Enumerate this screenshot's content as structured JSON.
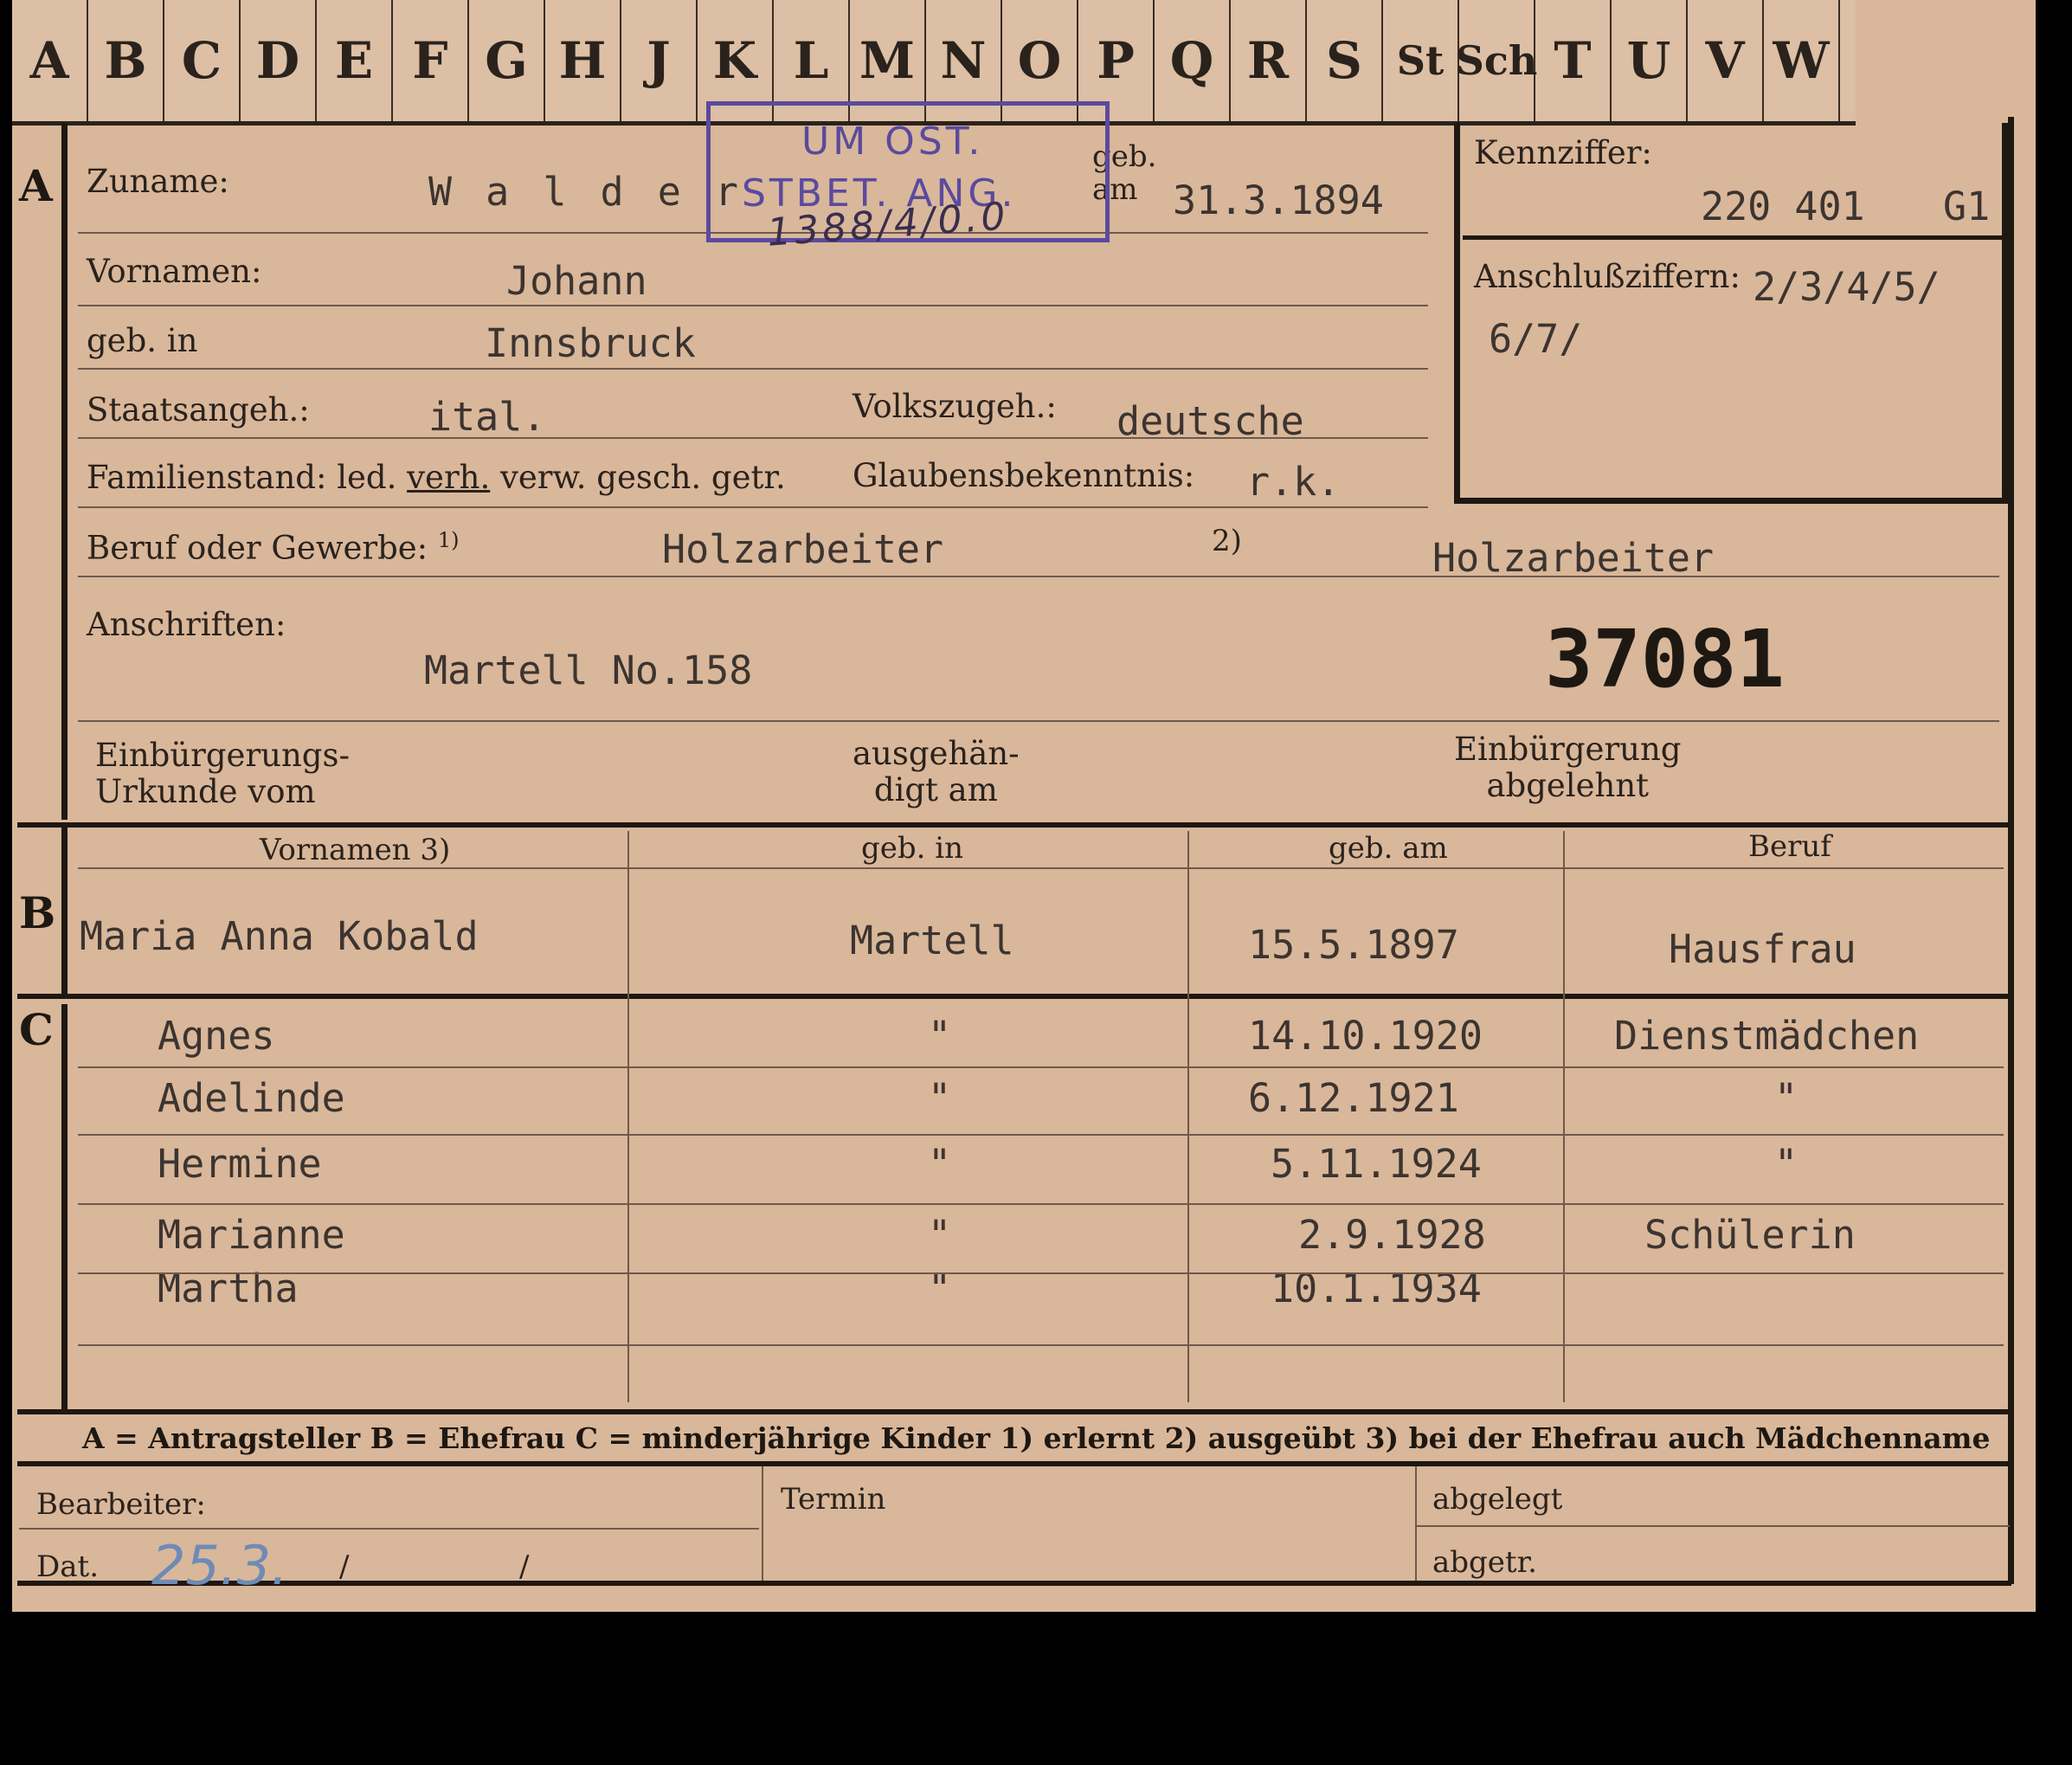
{
  "tabs": [
    "A",
    "B",
    "C",
    "D",
    "E",
    "F",
    "G",
    "H",
    "J",
    "K",
    "L",
    "M",
    "N",
    "O",
    "P",
    "Q",
    "R",
    "S",
    "St",
    "Sch",
    "T",
    "U",
    "V",
    "W"
  ],
  "sections": {
    "a": "A",
    "b": "B",
    "c": "C"
  },
  "stamp": {
    "line1": "UM OST.",
    "line2": "STBET. ANG.",
    "handwritten": "1388/4/0.0"
  },
  "labels": {
    "zuname": "Zuname:",
    "geb_am": "geb. am",
    "vornamen": "Vornamen:",
    "geb_in": "geb. in",
    "staatsangeh": "Staatsangeh.:",
    "volkszugeh": "Volkszugeh.:",
    "familienstand": "Familienstand: led.",
    "familienstand_verh": "verh.",
    "familienstand_rest": "verw. gesch. getr.",
    "glaubensbekenntnis": "Glaubensbekenntnis:",
    "beruf": "Beruf oder Gewerbe: ",
    "beruf_sup1": "1)",
    "beruf_sup2": "2)",
    "anschriften": "Anschriften:",
    "einbuergerungs": "Einbürgerungs-",
    "urkunde_vom": "Urkunde vom",
    "ausgehaen": "ausgehän-",
    "digt_am": "digt am",
    "einbuergerung": "Einbürgerung",
    "abgelehnt": "abgelehnt",
    "kennziffer": "Kennziffer:",
    "anschlussziffern": "Anschlußziffern:"
  },
  "applicant": {
    "zuname": "W a l d e r",
    "geb_am": "31.3.1894",
    "vornamen": "Johann",
    "geb_in": "Innsbruck",
    "staatsangeh": "ital.",
    "volkszugeh": "deutsche",
    "glaubensbekenntnis": "r.k.",
    "beruf_erlernt": "Holzarbeiter",
    "beruf_ausgeuebt": "Holzarbeiter",
    "anschrift": "Martell No.158",
    "number": "37081",
    "kennziffer": "220 401",
    "kennziffer_suffix": "G1",
    "anschlussziffern_1": "2/3/4/5/",
    "anschlussziffern_2": "6/7/"
  },
  "table_headers": {
    "vornamen": "Vornamen 3)",
    "geb_in": "geb. in",
    "geb_am": "geb. am",
    "beruf": "Beruf"
  },
  "wife": {
    "name": "Maria Anna Kobald",
    "geb_in": "Martell",
    "geb_am": "15.5.1897",
    "beruf": "Hausfrau"
  },
  "children": [
    {
      "name": "Agnes",
      "geb_in": "\"",
      "geb_am": "14.10.1920",
      "beruf": "Dienstmädchen"
    },
    {
      "name": "Adelinde",
      "geb_in": "\"",
      "geb_am": "6.12.1921",
      "beruf": "\""
    },
    {
      "name": "Hermine",
      "geb_in": "\"",
      "geb_am": "5.11.1924",
      "beruf": "\""
    },
    {
      "name": "Marianne",
      "geb_in": "\"",
      "geb_am": "2.9.1928",
      "beruf": "Schülerin"
    },
    {
      "name": "Martha",
      "geb_in": "\"",
      "geb_am": "10.1.1934",
      "beruf": ""
    }
  ],
  "legend": "A = Antragsteller   B = Ehefrau   C = minderjährige Kinder   1) erlernt   2) ausgeübt   3) bei der Ehefrau auch Mädchenname",
  "footer": {
    "bearbeiter": "Bearbeiter:",
    "dat": "Dat.",
    "dat_value": "25.3.",
    "slash1": "/",
    "slash2": "/",
    "termin": "Termin",
    "abgelegt": "abgelegt",
    "abgetr": "abgetr."
  }
}
